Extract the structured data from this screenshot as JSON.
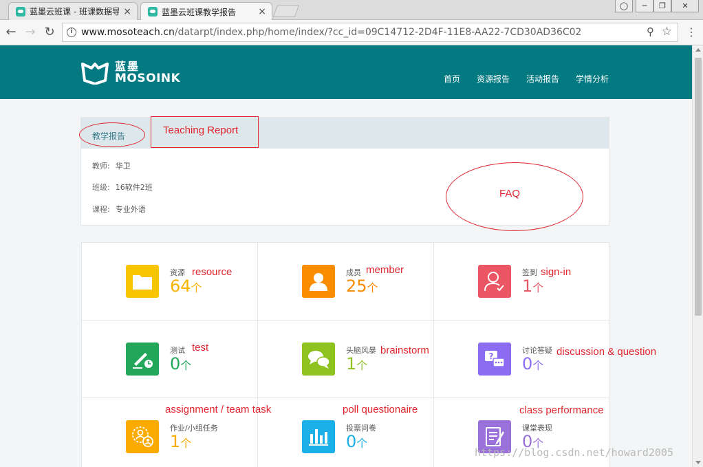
{
  "browser": {
    "tabs": [
      {
        "title": "蓝墨云班课 - 班课数据导",
        "active": false
      },
      {
        "title": "蓝墨云班课教学报告",
        "active": true
      }
    ],
    "close_glyph": "×",
    "url_host": "www.mosoteach.cn",
    "url_path": "/datarpt/index.php/home/index/?cc_id=09C14712-2D4F-11E8-AA22-7CD30AD36C02",
    "info_glyph": "i"
  },
  "site": {
    "brand_cn": "蓝墨",
    "brand_en": "MOSOINK",
    "header_color": "#037a82",
    "nav": [
      "首页",
      "资源报告",
      "活动报告",
      "学情分析"
    ]
  },
  "report": {
    "title": "教学报告",
    "rows": [
      {
        "label": "教师:",
        "value": "华卫"
      },
      {
        "label": "班级:",
        "value": "16软件2班"
      },
      {
        "label": "课程:",
        "value": "专业外语"
      }
    ]
  },
  "stats": [
    {
      "name": "资源",
      "value": "64",
      "unit": "个",
      "color": "#f8b400",
      "icon": "folder-icon"
    },
    {
      "name": "成员",
      "value": "25",
      "unit": "个",
      "color": "#fa8c00",
      "icon": "user-icon"
    },
    {
      "name": "签到",
      "value": "1",
      "unit": "个",
      "color": "#ea5664",
      "icon": "sign-in-icon"
    },
    {
      "name": "测试",
      "value": "0",
      "unit": "个",
      "color": "#22a75a",
      "icon": "test-icon"
    },
    {
      "name": "头脑风暴",
      "value": "1",
      "unit": "个",
      "color": "#8dc21f",
      "icon": "brainstorm-icon"
    },
    {
      "name": "讨论答疑",
      "value": "0",
      "unit": "个",
      "color": "#8c6cf2",
      "icon": "discussion-icon"
    },
    {
      "name": "作业/小组任务",
      "value": "1",
      "unit": "个",
      "color": "#fbaa00",
      "icon": "assignment-icon"
    },
    {
      "name": "投票问卷",
      "value": "0",
      "unit": "个",
      "color": "#1bb0e8",
      "icon": "poll-icon"
    },
    {
      "name": "课堂表现",
      "value": "0",
      "unit": "个",
      "color": "#9a71db",
      "icon": "performance-icon"
    }
  ],
  "annotations": {
    "teaching_report": "Teaching Report",
    "faq": "FAQ",
    "resource": "resource",
    "member": "member",
    "sign_in": "sign-in",
    "test": "test",
    "brainstorm": "brainstorm",
    "discussion": "discussion & question",
    "assignment": "assignment / team task",
    "poll": "poll questionaire",
    "performance": "class performance"
  },
  "watermark": "https://blog.csdn.net/howard2005"
}
